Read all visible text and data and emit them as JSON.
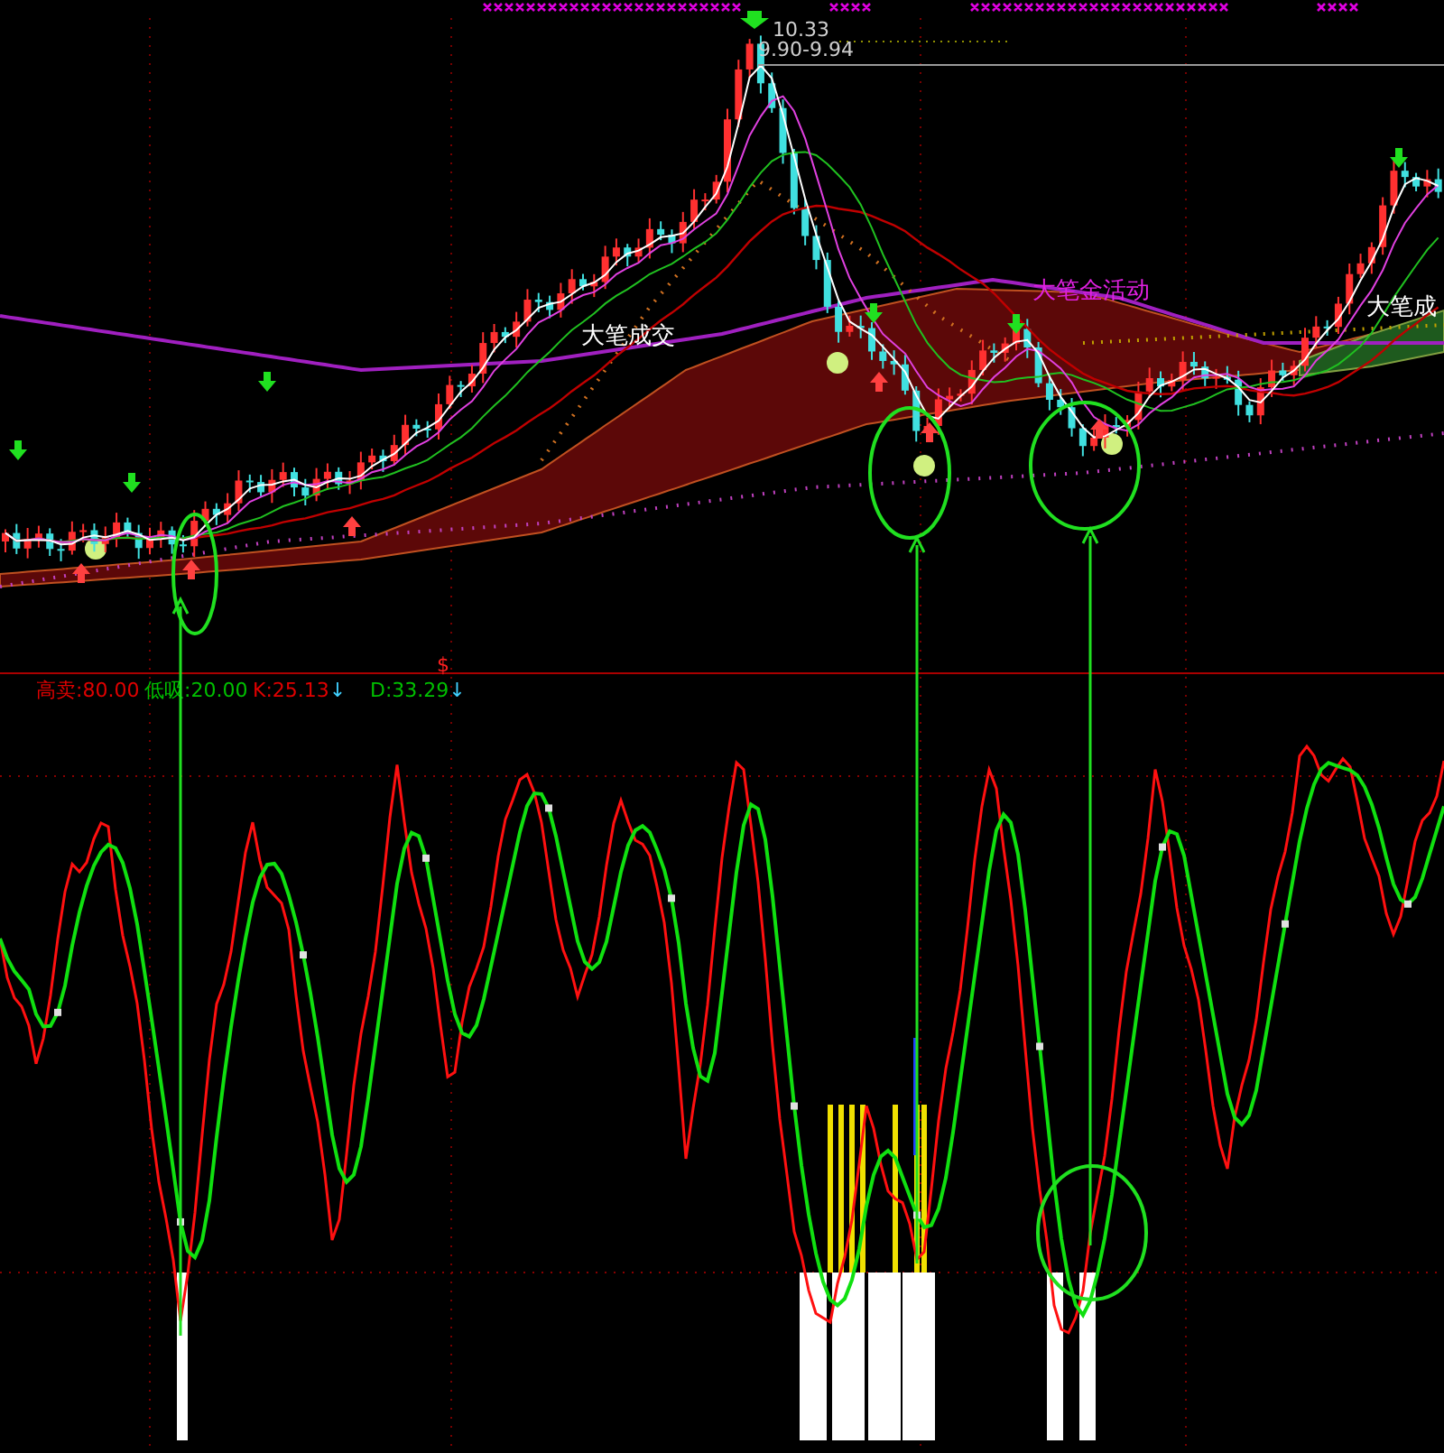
{
  "top_price_labels": [
    {
      "text": "10.33"
    },
    {
      "text": "9.90-9.94"
    }
  ],
  "annotations": [
    {
      "text": "大笔成交"
    },
    {
      "text": "大笔金活动"
    },
    {
      "text": "大笔成"
    }
  ],
  "signal_marker": {
    "text": "$"
  },
  "indicator_legend": [
    {
      "label": "高卖:80.00",
      "color": "#e00000"
    },
    {
      "label": "低吸:20.00",
      "color": "#00c000"
    },
    {
      "label": "K:25.13",
      "color": "#e00000",
      "arrow": "↓"
    },
    {
      "label": "D:33.29",
      "color": "#00c000",
      "arrow": "↓"
    }
  ]
}
